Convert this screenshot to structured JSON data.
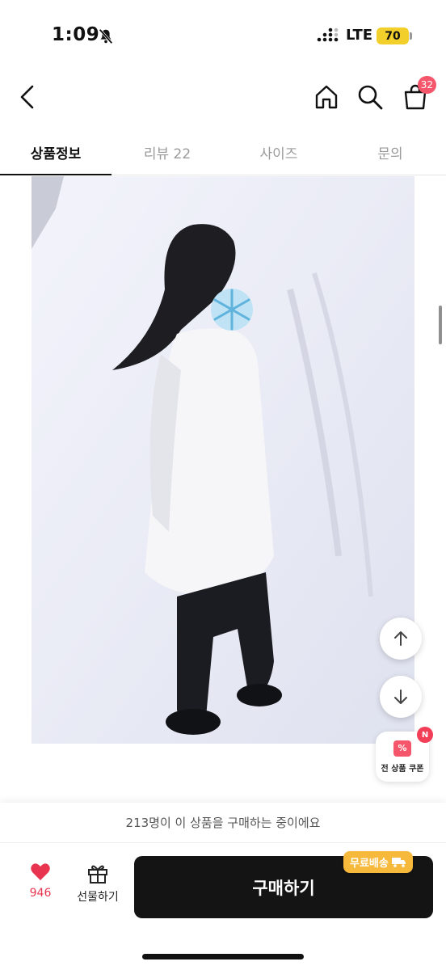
{
  "status_bar": {
    "time": "1:09",
    "network": "LTE",
    "battery": "70"
  },
  "nav": {
    "back_icon": "chevron-left-icon",
    "home_icon": "home-icon",
    "search_icon": "search-icon",
    "cart_icon": "shopping-bag-icon",
    "cart_count": "32"
  },
  "tabs": [
    {
      "label": "상품정보",
      "active": true
    },
    {
      "label": "리뷰 22",
      "active": false
    },
    {
      "label": "사이즈",
      "active": false
    },
    {
      "label": "문의",
      "active": false
    }
  ],
  "floating": {
    "scroll_up_icon": "arrow-up-icon",
    "scroll_down_icon": "arrow-down-icon",
    "coupon_label": "전 상품 쿠폰",
    "coupon_badge": "N"
  },
  "bottom": {
    "buying_text": "213명이 이 상품을 구매하는 중이에요",
    "like_count": "946",
    "gift_label": "선물하기",
    "buy_label": "구매하기",
    "shipping_badge": "무료배송"
  },
  "colors": {
    "accent_red": "#f5566b",
    "buy_button": "#141414",
    "shipping_badge": "#f6b93b"
  }
}
